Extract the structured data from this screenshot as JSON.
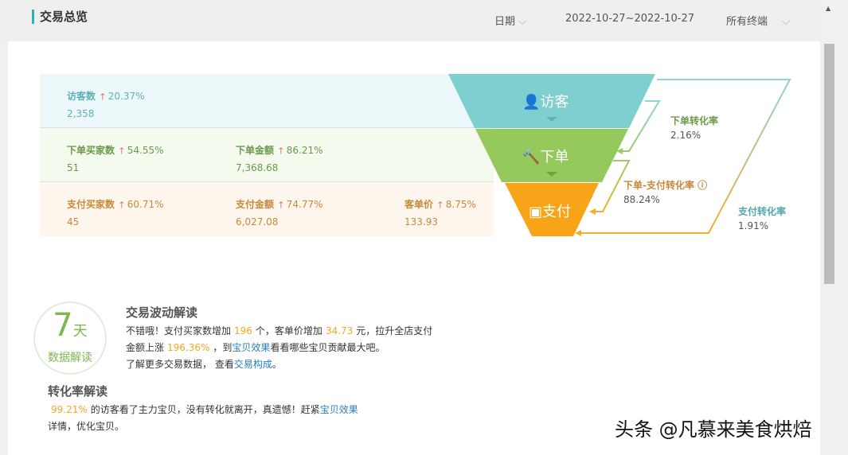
{
  "header": {
    "title": "交易总览",
    "date_label": "日期",
    "date_range": "2022-10-27~2022-10-27",
    "terminal": "所有终端"
  },
  "rows": [
    {
      "metrics": [
        {
          "label": "访客数",
          "change": "20.37%",
          "value": "2,358"
        }
      ]
    },
    {
      "metrics": [
        {
          "label": "下单买家数",
          "change": "54.55%",
          "value": "51"
        },
        {
          "label": "下单金额",
          "change": "86.21%",
          "value": "7,368.68"
        }
      ]
    },
    {
      "metrics": [
        {
          "label": "支付买家数",
          "change": "60.71%",
          "value": "45"
        },
        {
          "label": "支付金额",
          "change": "74.77%",
          "value": "6,027.08"
        },
        {
          "label": "客单价",
          "change": "8.75%",
          "value": "133.93"
        }
      ]
    }
  ],
  "funnel": {
    "visit": "访客",
    "order": "下单",
    "pay": "支付"
  },
  "rates": {
    "order_label": "下单转化率",
    "order_value": "2.16%",
    "order_pay_label": "下单-支付转化率",
    "order_pay_value": "88.24%",
    "pay_label": "支付转化率",
    "pay_value": "1.91%"
  },
  "badge": {
    "num": "7",
    "unit": "天",
    "text": "数据解读"
  },
  "fluct": {
    "title": "交易波动解读",
    "t1": "不错哦！支付买家数增加",
    "n1": "196",
    "t2": "个，客单价增加",
    "n2": "34.73",
    "t3": "元，拉升全店支付",
    "t4": "金额上涨",
    "n3": "196.36%",
    "t5": "，到",
    "link1": "宝贝效果",
    "t6": "看看哪些宝贝贡献最大吧。",
    "t7": "了解更多交易数据，  查看",
    "link2": "交易构成",
    "t8": "。"
  },
  "conv": {
    "title": "转化率解读",
    "n1": "99.21%",
    "t1": "的访客看了主力宝贝，没有转化就离开，真遗憾！赶紧",
    "link": "宝贝效果",
    "t2": "详情，优化宝贝。"
  },
  "watermark": "头条 @凡慕来美食烘焙",
  "colors": {
    "teal": "#7ecfd0",
    "green": "#96c95c",
    "orange": "#f7a418"
  }
}
